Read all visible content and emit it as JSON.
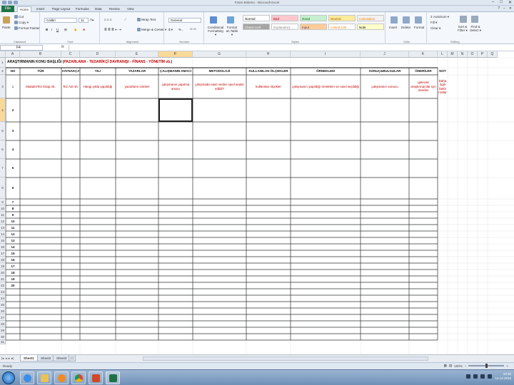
{
  "window": {
    "title": "Föüm Bölümü - Microsoft Excel"
  },
  "tabs": [
    "File",
    "Home",
    "Insert",
    "Page Layout",
    "Formulas",
    "Data",
    "Review",
    "View"
  ],
  "ribbon": {
    "clipboard": {
      "title": "Clipboard",
      "paste": "Paste",
      "cut": "Cut",
      "copy": "Copy ▾",
      "painter": "Format Painter"
    },
    "font": {
      "title": "Font",
      "name": "Calibri",
      "size": "11",
      "bold": "B",
      "italic": "I",
      "underline": "U"
    },
    "alignment": {
      "title": "Alignment",
      "wrap": "Wrap Text",
      "merge": "Merge & Center ▾"
    },
    "number": {
      "title": "Number",
      "format": "General",
      "pct": "% ,"
    },
    "styles": {
      "title": "Styles",
      "conditional": "Conditional Formatting ▾",
      "format_table": "Format as Table ▾",
      "cells": [
        {
          "label": "Normal",
          "bg": "#ffffff",
          "fg": "#000000"
        },
        {
          "label": "Bad",
          "bg": "#ffc7ce",
          "fg": "#9c0006"
        },
        {
          "label": "Good",
          "bg": "#c6efce",
          "fg": "#006100"
        },
        {
          "label": "Neutral",
          "bg": "#ffeb9c",
          "fg": "#9c6500"
        },
        {
          "label": "Calculation",
          "bg": "#f2f2f2",
          "fg": "#fa7d00"
        },
        {
          "label": "Check Cell",
          "bg": "#a5a5a5",
          "fg": "#ffffff"
        },
        {
          "label": "Explanatory ...",
          "bg": "#ffffff",
          "fg": "#7f7f7f"
        },
        {
          "label": "Input",
          "bg": "#ffcc99",
          "fg": "#3f3f76"
        },
        {
          "label": "Linked Cell",
          "bg": "#ffffff",
          "fg": "#fa7d00"
        },
        {
          "label": "Note",
          "bg": "#ffffcc",
          "fg": "#000000"
        }
      ]
    },
    "cells": {
      "title": "Cells",
      "insert": "Insert",
      "delete": "Delete",
      "format": "Format"
    },
    "editing": {
      "title": "Editing",
      "autosum": "Σ AutoSum ▾",
      "fill": "Fill ▾",
      "clear": "Clear ▾",
      "sort": "Sort & Filter ▾",
      "find": "Find & Select ▾"
    }
  },
  "formula_bar": {
    "name_box": "F4",
    "fx": "fx",
    "value": ""
  },
  "columns": [
    "A",
    "B",
    "C",
    "D",
    "E",
    "F",
    "G",
    "H",
    "I",
    "J",
    "K",
    "L",
    "M",
    "N",
    "O",
    "P",
    "Q"
  ],
  "selected_column": "F",
  "selected_row": "4",
  "row_numbers": [
    "1",
    "2",
    "3",
    "4",
    "5",
    "6",
    "7",
    "8",
    "9",
    "10",
    "11",
    "12",
    "13",
    "14",
    "15",
    "16",
    "17",
    "18",
    "19",
    "20",
    "21",
    "22",
    "23",
    "24",
    "25",
    "26",
    "27",
    "28",
    "29",
    "30",
    "31"
  ],
  "sheet": {
    "title_prefix": "ARAŞTIRMANIN KONU BAŞLIĞI (",
    "title_red": "PAZARLAMA - TEDARİKÇİ DAVRANIŞI - FİNANS - YÖNETİM vb.",
    "title_suffix": ")",
    "headers": [
      "NO",
      "TÜR",
      "KAYNAKÇA",
      "YILI",
      "YAZARLAR",
      "ÇALIŞMANIN AMACI",
      "METODOLOJİ",
      "KULLANILAN ÖLÇEKLER",
      "ÖRNEKLEM",
      "SONUÇ&BULGULAR",
      "ÖNERİLER",
      "NOT"
    ],
    "row1_red": [
      "Makale/Tez Kitap vb.",
      "Tez Adı vb.",
      "Hangi yılda yapıldığı",
      "yazarların isimleri",
      "çalışmanın yapılma amacı",
      "çalışmada nasıl veriler nasıl analiz edildi?",
      "kullanılan ölçekler",
      "çalışmanın yapıldığı örneklem ve nasıl seçildiği",
      "çalışmanın sonucu",
      "gelecek araştırmacılar için öneriler",
      "Daha ilgili farklı notlar"
    ],
    "numbers": [
      "1",
      "2",
      "3",
      "4",
      "5",
      "6",
      "7",
      "8",
      "9",
      "10",
      "11",
      "12",
      "13",
      "14",
      "15",
      "16",
      "17",
      "18",
      "19",
      "20"
    ]
  },
  "sheet_tabs": [
    "Sheet1",
    "Sheet2",
    "Sheet3"
  ],
  "active_sheet": "Sheet1",
  "status": {
    "text": "Ready",
    "zoom": "100%",
    "zoom_level": 0.5
  },
  "taskbar": {
    "time": "10:30",
    "date": "14.12.2015"
  }
}
